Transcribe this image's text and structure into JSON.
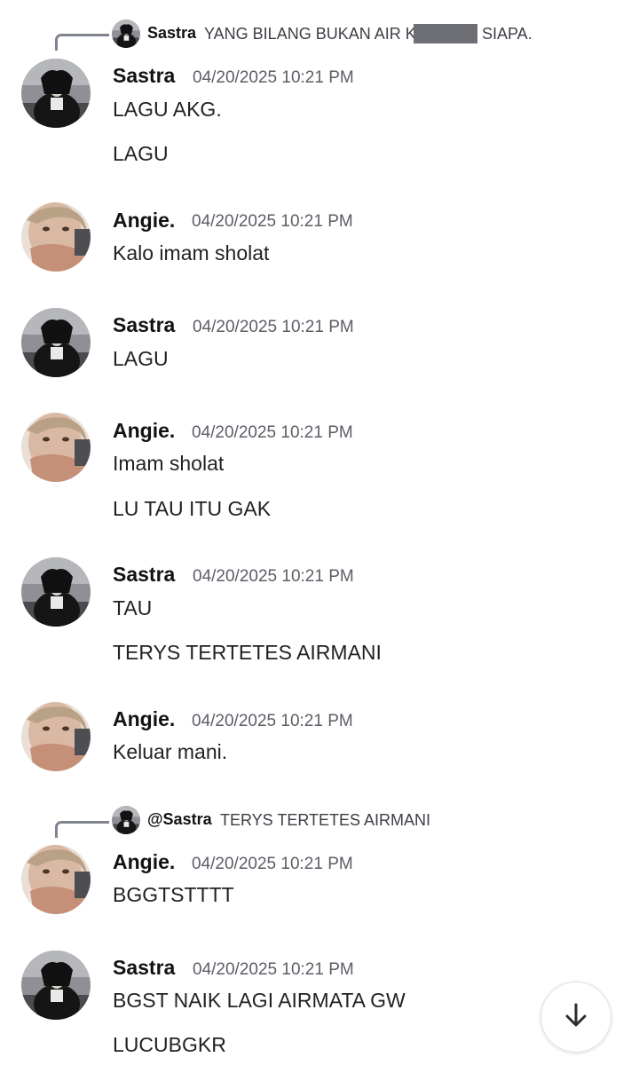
{
  "reply1": {
    "author": "Sastra",
    "text_before": "YANG BILANG BUKAN AIR K",
    "text_after": "SIAPA."
  },
  "reply2": {
    "author": "@Sastra",
    "text": "TERYS TERTETES AIRMANI"
  },
  "messages": [
    {
      "author": "Sastra",
      "timestamp": "04/20/2025 10:21 PM",
      "lines": [
        "LAGU AKG.",
        "LAGU"
      ]
    },
    {
      "author": "Angie.",
      "timestamp": "04/20/2025 10:21 PM",
      "lines": [
        "Kalo imam sholat"
      ]
    },
    {
      "author": "Sastra",
      "timestamp": "04/20/2025 10:21 PM",
      "lines": [
        "LAGU"
      ]
    },
    {
      "author": "Angie.",
      "timestamp": "04/20/2025 10:21 PM",
      "lines": [
        "Imam sholat",
        "LU TAU ITU GAK"
      ]
    },
    {
      "author": "Sastra",
      "timestamp": "04/20/2025 10:21 PM",
      "lines": [
        "TAU",
        "TERYS TERTETES AIRMANI"
      ]
    },
    {
      "author": "Angie.",
      "timestamp": "04/20/2025 10:21 PM",
      "lines": [
        "Keluar mani."
      ]
    },
    {
      "author": "Angie.",
      "timestamp": "04/20/2025 10:21 PM",
      "lines": [
        "BGGTSTTTT"
      ]
    },
    {
      "author": "Sastra",
      "timestamp": "04/20/2025 10:21 PM",
      "lines": [
        "BGST NAIK LAGI AIRMATA GW",
        "LUCUBGKR"
      ]
    }
  ],
  "icons": {
    "scroll": "arrow-down-icon",
    "avatar_sastra": "sastra-avatar",
    "avatar_angie": "angie-avatar"
  },
  "colors": {
    "background": "#ffffff",
    "name": "#111214",
    "timestamp": "#5c5e66",
    "text": "#1f2124"
  }
}
